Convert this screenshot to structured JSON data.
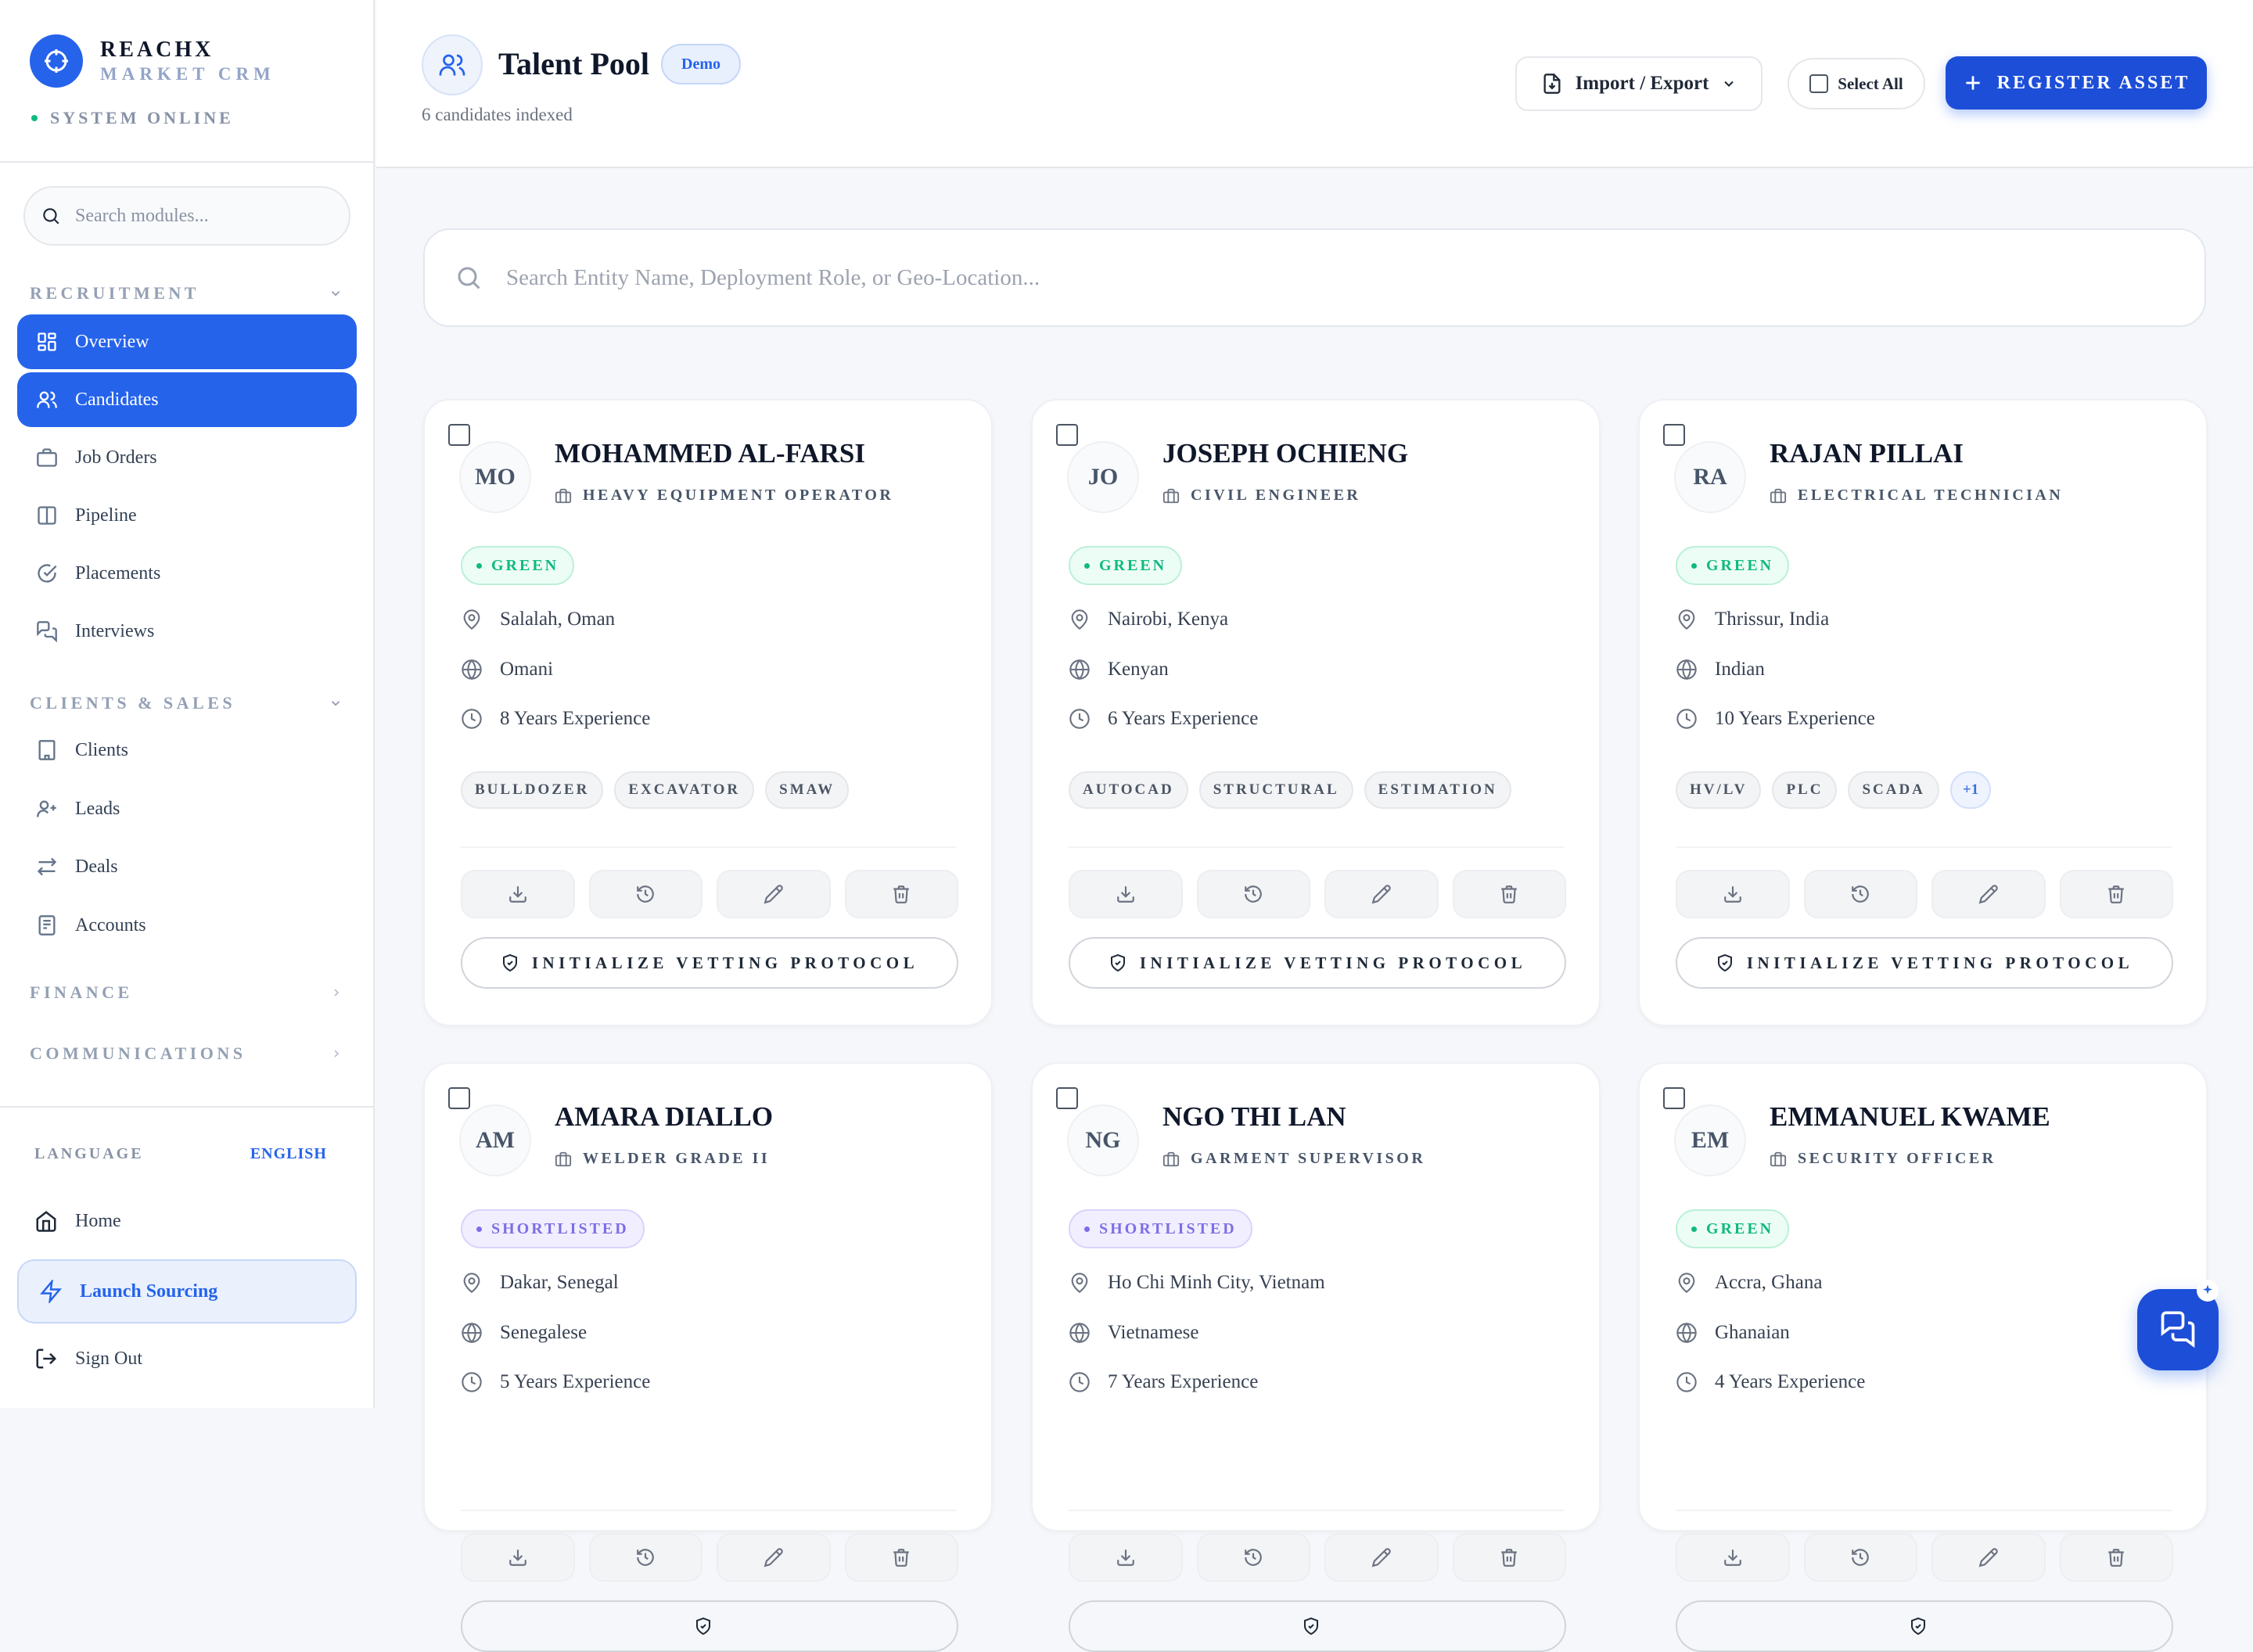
{
  "brand": {
    "name": "REACHX",
    "sub": "MARKET CRM",
    "status": "SYSTEM ONLINE"
  },
  "sidebar": {
    "search_placeholder": "Search modules...",
    "sections": [
      {
        "label": "RECRUITMENT",
        "items": [
          {
            "label": "Overview",
            "icon": "grid-icon"
          },
          {
            "label": "Candidates",
            "icon": "users-icon"
          },
          {
            "label": "Job Orders",
            "icon": "briefcase-icon"
          },
          {
            "label": "Pipeline",
            "icon": "columns-icon"
          },
          {
            "label": "Placements",
            "icon": "check-circle-icon"
          },
          {
            "label": "Interviews",
            "icon": "chat-icon"
          }
        ]
      },
      {
        "label": "CLIENTS & SALES",
        "items": [
          {
            "label": "Clients",
            "icon": "building-icon"
          },
          {
            "label": "Leads",
            "icon": "user-plus-icon"
          },
          {
            "label": "Deals",
            "icon": "arrows-icon"
          },
          {
            "label": "Accounts",
            "icon": "ledger-icon"
          }
        ]
      },
      {
        "label": "FINANCE"
      },
      {
        "label": "COMMUNICATIONS"
      }
    ],
    "language_label": "LANGUAGE",
    "language_value": "ENGLISH",
    "home": "Home",
    "launch": "Launch Sourcing",
    "signout": "Sign Out"
  },
  "header": {
    "title": "Talent Pool",
    "badge": "Demo",
    "count_text": "6 candidates indexed",
    "import_export": "Import / Export",
    "select_all": "Select All",
    "register": "REGISTER ASSET"
  },
  "search": {
    "placeholder": "Search Entity Name, Deployment Role, or Geo-Location..."
  },
  "candidates": [
    {
      "initials": "MO",
      "name": "MOHAMMED AL-FARSI",
      "role": "HEAVY EQUIPMENT OPERATOR",
      "status": "GREEN",
      "location": "Salalah, Oman",
      "nationality": "Omani",
      "experience": "8 Years Experience",
      "tags": [
        "BULLDOZER",
        "EXCAVATOR",
        "SMAW"
      ],
      "more": "",
      "vet": "INITIALIZE VETTING PROTOCOL"
    },
    {
      "initials": "JO",
      "name": "JOSEPH OCHIENG",
      "role": "CIVIL ENGINEER",
      "status": "GREEN",
      "location": "Nairobi, Kenya",
      "nationality": "Kenyan",
      "experience": "6 Years Experience",
      "tags": [
        "AUTOCAD",
        "STRUCTURAL",
        "ESTIMATION"
      ],
      "more": "",
      "vet": "INITIALIZE VETTING PROTOCOL"
    },
    {
      "initials": "RA",
      "name": "RAJAN PILLAI",
      "role": "ELECTRICAL TECHNICIAN",
      "status": "GREEN",
      "location": "Thrissur, India",
      "nationality": "Indian",
      "experience": "10 Years Experience",
      "tags": [
        "HV/LV",
        "PLC",
        "SCADA"
      ],
      "more": "+1",
      "vet": "INITIALIZE VETTING PROTOCOL"
    },
    {
      "initials": "AM",
      "name": "AMARA DIALLO",
      "role": "WELDER GRADE II",
      "status": "SHORTLISTED",
      "location": "Dakar, Senegal",
      "nationality": "Senegalese",
      "experience": "5 Years Experience"
    },
    {
      "initials": "NG",
      "name": "NGO THI LAN",
      "role": "GARMENT SUPERVISOR",
      "status": "SHORTLISTED",
      "location": "Ho Chi Minh City, Vietnam",
      "nationality": "Vietnamese",
      "experience": "7 Years Experience"
    },
    {
      "initials": "EM",
      "name": "EMMANUEL KWAME",
      "role": "SECURITY OFFICER",
      "status": "GREEN",
      "location": "Accra, Ghana",
      "nationality": "Ghanaian",
      "experience": "4 Years Experience"
    }
  ],
  "colors": {
    "accent": "#2563eb",
    "green": "#10b981",
    "shortlisted": "#7c6ee6"
  }
}
